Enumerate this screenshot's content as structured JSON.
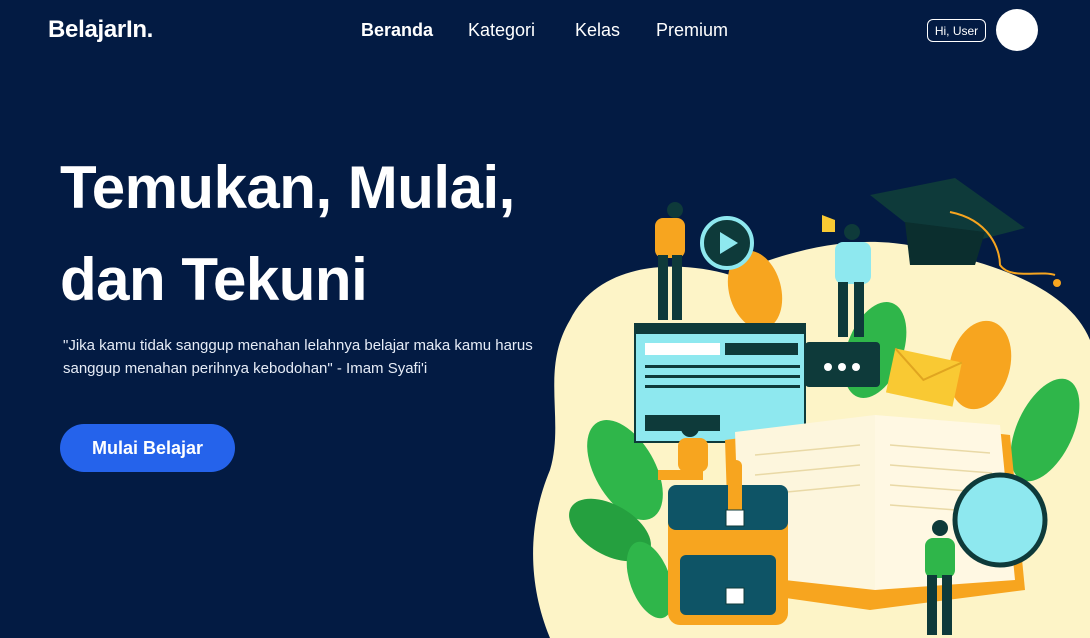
{
  "brand": {
    "logo_text": "BelajarIn."
  },
  "nav": {
    "items": [
      {
        "label": "Beranda",
        "active": true
      },
      {
        "label": "Kategori",
        "active": false
      },
      {
        "label": "Kelas",
        "active": false
      },
      {
        "label": "Premium",
        "active": false
      }
    ]
  },
  "user": {
    "greeting": "Hi, User"
  },
  "hero": {
    "headline_line1": "Temukan, Mulai,",
    "headline_line2": "dan Tekuni",
    "quote": "\"Jika kamu tidak sanggup menahan lelahnya belajar maka kamu harus sanggup menahan perihnya kebodohan\" - Imam Syafi'i",
    "cta_label": "Mulai Belajar"
  },
  "colors": {
    "background": "#031b43",
    "accent": "#2563eb",
    "illustration_cream": "#fdf4c7",
    "illustration_green": "#2fb64a",
    "illustration_orange": "#f7a51f",
    "illustration_teal": "#8ee8ef"
  }
}
